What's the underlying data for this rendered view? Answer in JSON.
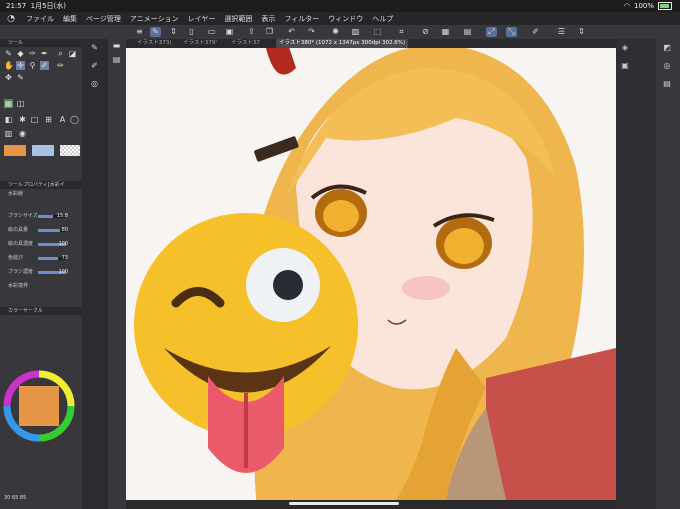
{
  "status": {
    "time": "21:57",
    "date": "1月5日(水)",
    "battery": "100%"
  },
  "menu": [
    "ファイル",
    "編集",
    "ページ管理",
    "アニメーション",
    "レイヤー",
    "選択範囲",
    "表示",
    "フィルター",
    "ウィンドウ",
    "ヘルプ"
  ],
  "tabs": [
    "イラスト373(",
    "イラスト379'",
    "イラスト37",
    "イラスト380* (1072 x 1347px 300dpi 302.6%)"
  ],
  "panels": {
    "tool": "ツール",
    "tool_property": "ツールプロパティ[水彩イ",
    "color_circle": "カラーサークル"
  },
  "brush_name": "水彩線",
  "properties": [
    {
      "label": "ブラシサイズ",
      "value": "15.8",
      "fill": 0.55
    },
    {
      "label": "絵の具量",
      "value": "80",
      "fill": 0.8
    },
    {
      "label": "絵の具濃度",
      "value": "100",
      "fill": 1.0
    },
    {
      "label": "色延び",
      "value": "73",
      "fill": 0.73
    },
    {
      "label": "ブラシ濃度",
      "value": "100",
      "fill": 1.0
    }
  ],
  "blend_label": "水彩境界",
  "hsv": "30  65  85",
  "colors": {
    "main": "#e69647",
    "sub": "#a7c2e6",
    "accent": "#5a6f9a"
  }
}
